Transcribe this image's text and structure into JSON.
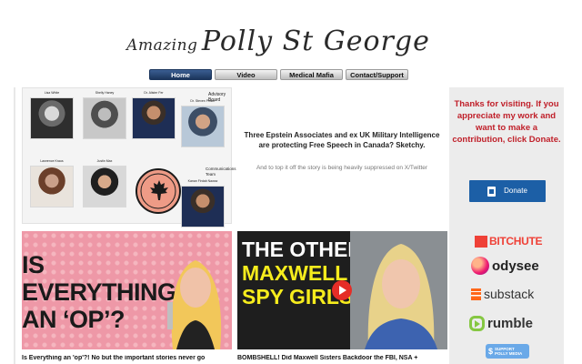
{
  "header": {
    "title_prefix": "Amazing",
    "title_main": "Polly St George"
  },
  "nav": [
    {
      "label": "Home",
      "active": true
    },
    {
      "label": "Video",
      "active": false
    },
    {
      "label": "Medical Mafia",
      "active": false
    },
    {
      "label": "Contact/Support",
      "active": false
    }
  ],
  "collage": {
    "advisory_label": "Advisory Board",
    "communications_label": "Communications Team",
    "people": [
      {
        "name": "Lisa White"
      },
      {
        "name": "Shelly Haney"
      },
      {
        "name": "Dr. Alister Fer"
      },
      {
        "name": "Lawrence Kraus"
      },
      {
        "name": "Justin Max"
      },
      {
        "name": "Bruce Pardy"
      },
      {
        "name": "Dr. Steven Pinker"
      },
      {
        "name": "Hannah Rich Naime"
      },
      {
        "name": "Tyler Young"
      },
      {
        "name": "Kanan Firdab Nawaz"
      }
    ],
    "stamp_text": "FREE SPEECH UNION OF CANADA",
    "stamp_url": "fsucanada.org"
  },
  "article": {
    "headline": "Three Epstein Associates and ex UK Military Intelligence are protecting Free Speech in Canada? Sketchy.",
    "subtext": "And to top it off the story is being heavily suppressed on X/Twitter"
  },
  "sidebar": {
    "thanks_text": "Thanks for visiting. If you appreciate my work and want to make a contribution, click Donate.",
    "donate_label": "Donate",
    "platforms": {
      "bitchute": "BITCHUTE",
      "odysee": "odysee",
      "substack": "substack",
      "rumble": "rumble",
      "support_line1": "SUPPORT",
      "support_line2": "POLLY MEDIA"
    }
  },
  "videos": [
    {
      "thumb_line1": "IS",
      "thumb_line2": "EVERYTHING",
      "thumb_line3": "AN ‘OP’?",
      "caption": "Is Everything an 'op'?! No but the important stories never go"
    },
    {
      "thumb_line1": "THE OTHER",
      "thumb_line2": "MAXWELL",
      "thumb_line3": "SPY GIRLS",
      "caption": "BOMBSHELL! Did Maxwell Sisters Backdoor the FBI, NSA +"
    }
  ],
  "colors": {
    "nav_active": "#1b355c",
    "thanks_red": "#c0202a",
    "donate_blue": "#1c5fa6",
    "bitchute_red": "#ef4137",
    "substack_orange": "#ff6719",
    "rumble_green": "#85c742",
    "thumb_pink": "#ee98a7",
    "thumb_yellow": "#f6ec1d"
  }
}
